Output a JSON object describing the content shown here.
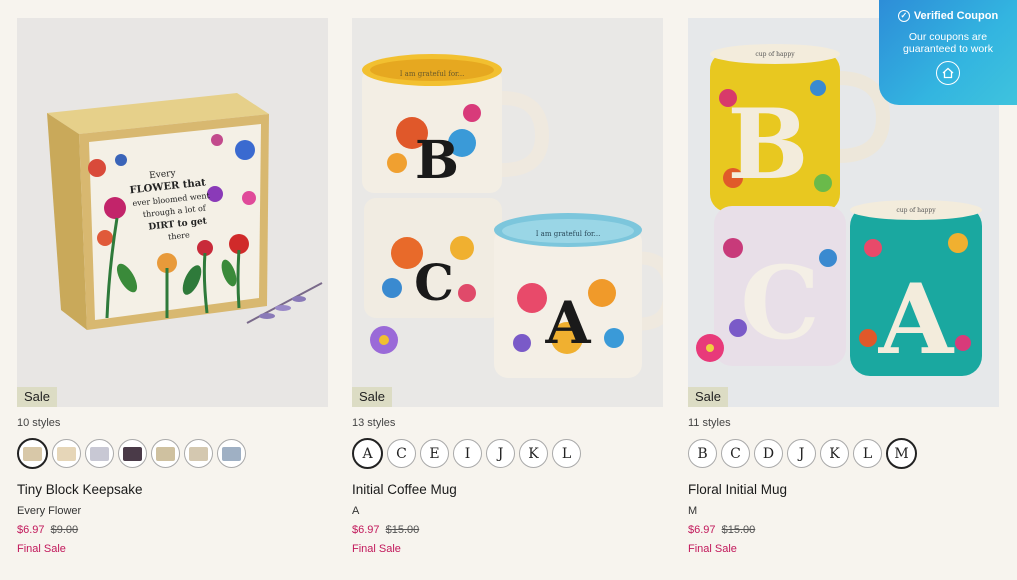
{
  "coupon": {
    "title": "Verified Coupon",
    "subtitle": "Our coupons are guaranteed to work",
    "icon": "home-icon",
    "check_icon": "check-circle-icon"
  },
  "products": [
    {
      "badge": "Sale",
      "styles_count": "10 styles",
      "swatches": [
        {
          "type": "image",
          "color": "#d8c8a8"
        },
        {
          "type": "image",
          "color": "#e6d6b8"
        },
        {
          "type": "image",
          "color": "#c8c8d4"
        },
        {
          "type": "image",
          "color": "#4a3a48"
        },
        {
          "type": "image",
          "color": "#cfc1a0"
        },
        {
          "type": "image",
          "color": "#d4c8b0"
        },
        {
          "type": "image",
          "color": "#9fb0c4"
        }
      ],
      "selected_swatch": 0,
      "title": "Tiny Block Keepsake",
      "variant": "Every Flower",
      "price_now": "$6.97",
      "price_was": "$9.00",
      "final": "Final Sale",
      "photo_text": [
        "Every",
        "FLOWER that",
        "ever bloomed went",
        "through a lot of",
        "DIRT to get",
        "there"
      ]
    },
    {
      "badge": "Sale",
      "styles_count": "13 styles",
      "swatches": [
        {
          "type": "letter",
          "label": "A"
        },
        {
          "type": "letter",
          "label": "C"
        },
        {
          "type": "letter",
          "label": "E"
        },
        {
          "type": "letter",
          "label": "I"
        },
        {
          "type": "letter",
          "label": "J"
        },
        {
          "type": "letter",
          "label": "K"
        },
        {
          "type": "letter",
          "label": "L"
        }
      ],
      "selected_swatch": 0,
      "title": "Initial Coffee Mug",
      "variant": "A",
      "price_now": "$6.97",
      "price_was": "$15.00",
      "final": "Final Sale",
      "photo_text": [
        "I am grateful for...",
        "I am grateful for..."
      ]
    },
    {
      "badge": "Sale",
      "styles_count": "11 styles",
      "swatches": [
        {
          "type": "letter",
          "label": "B"
        },
        {
          "type": "letter",
          "label": "C"
        },
        {
          "type": "letter",
          "label": "D"
        },
        {
          "type": "letter",
          "label": "J"
        },
        {
          "type": "letter",
          "label": "K"
        },
        {
          "type": "letter",
          "label": "L"
        },
        {
          "type": "letter",
          "label": "M"
        }
      ],
      "selected_swatch": 6,
      "title": "Floral Initial Mug",
      "variant": "M",
      "price_now": "$6.97",
      "price_was": "$15.00",
      "final": "Final Sale",
      "photo_text": [
        "cup of happy",
        "cup of happy"
      ]
    }
  ]
}
